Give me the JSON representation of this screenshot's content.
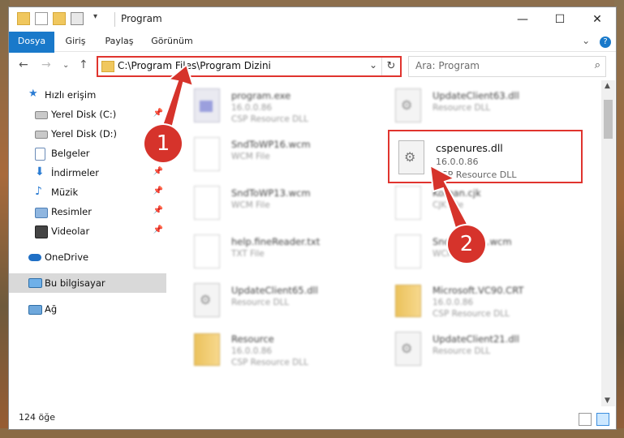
{
  "window": {
    "title": "Program",
    "minimize": "—",
    "maximize": "☐",
    "close": "✕"
  },
  "ribbon": {
    "tabs": [
      "Dosya",
      "Giriş",
      "Paylaş",
      "Görünüm"
    ],
    "chevron": "⌄",
    "help": "?"
  },
  "nav": {
    "back": "←",
    "forward": "→",
    "recent": "⌄",
    "up": "↑",
    "address": "C:\\Program Files\\Program Dizini",
    "address_chevron": "⌄",
    "refresh": "↻",
    "search_placeholder": "Ara: Program",
    "search_icon": "⌕"
  },
  "sidebar": {
    "items": [
      {
        "label": "Hızlı erişim",
        "icon": "star-icon",
        "pinned": false
      },
      {
        "label": "Yerel Disk (C:)",
        "icon": "drive-icon",
        "pinned": true
      },
      {
        "label": "Yerel Disk (D:)",
        "icon": "drive-icon",
        "pinned": true
      },
      {
        "label": "Belgeler",
        "icon": "documents-icon",
        "pinned": true
      },
      {
        "label": "İndirmeler",
        "icon": "download-icon",
        "pinned": true
      },
      {
        "label": "Müzik",
        "icon": "music-icon",
        "pinned": true
      },
      {
        "label": "Resimler",
        "icon": "pictures-icon",
        "pinned": true
      },
      {
        "label": "Videolar",
        "icon": "videos-icon",
        "pinned": true
      },
      {
        "label": "OneDrive",
        "icon": "cloud-icon",
        "pinned": false
      },
      {
        "label": "Bu bilgisayar",
        "icon": "computer-icon",
        "pinned": false
      },
      {
        "label": "Ağ",
        "icon": "network-icon",
        "pinned": false
      }
    ],
    "pin_glyph": "📌"
  },
  "files": [
    {
      "name": "program.exe",
      "sub1": "16.0.0.86",
      "sub2": "CSP Resource DLL",
      "kind": "exe"
    },
    {
      "name": "UpdateClient63.dll",
      "sub1": "Resource DLL",
      "sub2": "",
      "kind": "dll"
    },
    {
      "name": "SndToWP16.wcm",
      "sub1": "WCM File",
      "sub2": "",
      "kind": "doc"
    },
    {
      "name": "cspenures.dll",
      "sub1": "16.0.0.86",
      "sub2": "CSP Resource DLL",
      "kind": "dll"
    },
    {
      "name": "SndToWP13.wcm",
      "sub1": "WCM File",
      "sub2": "",
      "kind": "doc"
    },
    {
      "name": "Korean.cjk",
      "sub1": "CJK File",
      "sub2": "",
      "kind": "doc"
    },
    {
      "name": "help.fineReader.txt",
      "sub1": "TXT File",
      "sub2": "",
      "kind": "doc"
    },
    {
      "name": "SndToWP11.wcm",
      "sub1": "WCM File",
      "sub2": "",
      "kind": "doc"
    },
    {
      "name": "UpdateClient65.dll",
      "sub1": "Resource DLL",
      "sub2": "",
      "kind": "dll"
    },
    {
      "name": "Microsoft.VC90.CRT",
      "sub1": "16.0.0.86",
      "sub2": "CSP Resource DLL",
      "kind": "folder"
    },
    {
      "name": "Resource",
      "sub1": "16.0.0.86",
      "sub2": "CSP Resource DLL",
      "kind": "folder"
    },
    {
      "name": "UpdateClient21.dll",
      "sub1": "Resource DLL",
      "sub2": "",
      "kind": "dll"
    }
  ],
  "status": {
    "count": "124 öğe"
  },
  "annotations": {
    "badge1": "1",
    "badge2": "2",
    "color": "#d6332b"
  }
}
